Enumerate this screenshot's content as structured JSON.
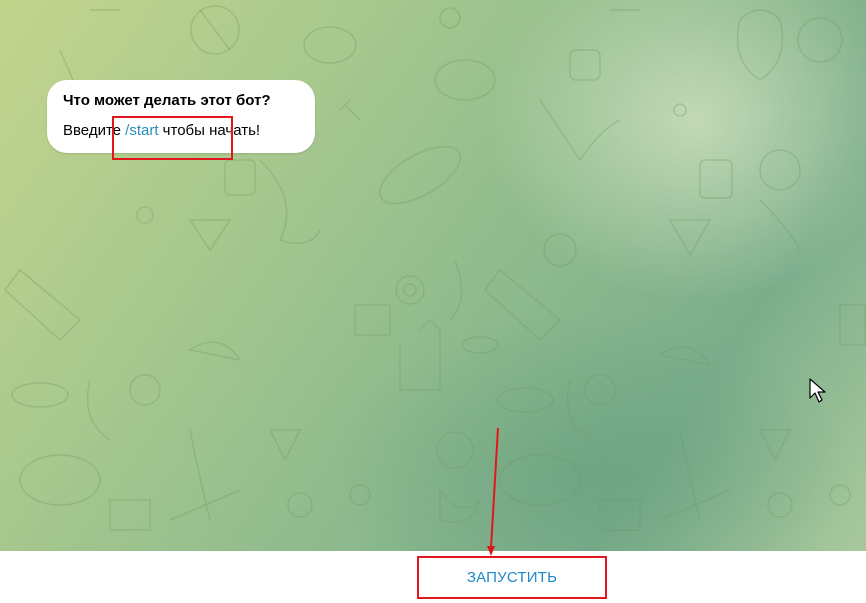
{
  "bot_info": {
    "title": "Что может делать этот бот?",
    "text_before": "Введите ",
    "command": "/start",
    "text_after": " чтобы начать!"
  },
  "start_button": {
    "label": "ЗАПУСТИТЬ"
  },
  "colors": {
    "command_link": "#2a8ec0",
    "start_button_text": "#1f87c9",
    "highlight": "#e0171c",
    "bubble_bg": "#ffffff"
  },
  "icons": [
    "doodle-wallpaper",
    "mouse-cursor-icon",
    "annotation-arrow"
  ]
}
